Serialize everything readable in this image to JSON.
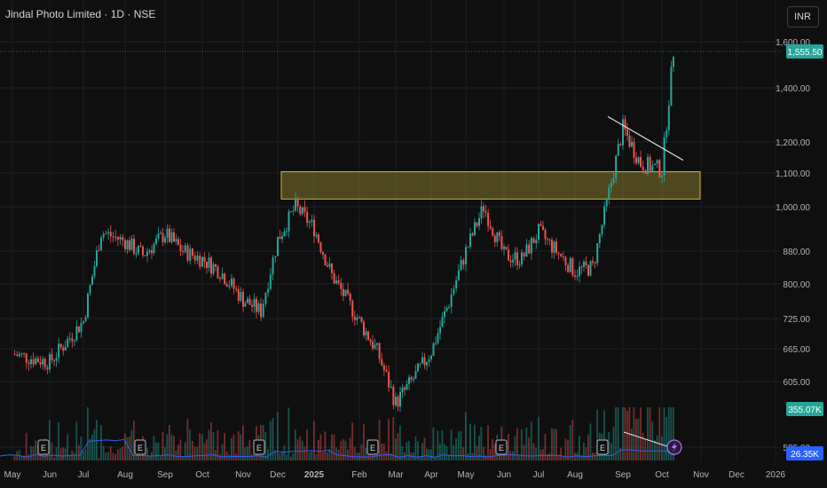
{
  "header": {
    "title": "Jindal Photo Limited · 1D · NSE",
    "currency": "INR"
  },
  "chart_data": {
    "type": "candlestick",
    "title": "Jindal Photo Limited · 1D · NSE",
    "price_scale": "log",
    "y_ticks": [
      "1,600.00",
      "1,400.00",
      "1,200.00",
      "1,100.00",
      "1,000.00",
      "880.00",
      "800.00",
      "725.00",
      "665.00",
      "605.00",
      "505.00"
    ],
    "y_tick_values": [
      1600,
      1400,
      1200,
      1100,
      1000,
      880,
      800,
      725,
      665,
      605,
      505
    ],
    "x_ticks": [
      "May",
      "Jun",
      "Jul",
      "Aug",
      "Sep",
      "Oct",
      "Nov",
      "Dec",
      "2025",
      "Feb",
      "Mar",
      "Apr",
      "May",
      "Jun",
      "Jul",
      "Aug",
      "Sep",
      "Oct",
      "Nov",
      "Dec",
      "2026"
    ],
    "last_price": "1,555.50",
    "last_price_value": 1555.5,
    "volume_label": "355.07K",
    "volume_avg_label": "26.35K",
    "earnings_marker": "E",
    "earnings_months": [
      "Jul",
      "Aug",
      "Nov",
      "Feb",
      "Jun",
      "Aug"
    ],
    "price_path": [
      [
        "May",
        655
      ],
      [
        "Jun",
        640
      ],
      [
        "Jul",
        720
      ],
      [
        "Jul",
        930
      ],
      [
        "Aug",
        905
      ],
      [
        "Aug",
        870
      ],
      [
        "Sep",
        925
      ],
      [
        "Sep",
        880
      ],
      [
        "Oct",
        860
      ],
      [
        "Oct",
        830
      ],
      [
        "Nov",
        765
      ],
      [
        "Nov",
        740
      ],
      [
        "Dec",
        910
      ],
      [
        "Dec",
        1000
      ],
      [
        "2025",
        940
      ],
      [
        "2025",
        820
      ],
      [
        "Feb",
        720
      ],
      [
        "Feb",
        660
      ],
      [
        "Mar",
        570
      ],
      [
        "Mar",
        610
      ],
      [
        "Apr",
        660
      ],
      [
        "Apr",
        760
      ],
      [
        "May",
        880
      ],
      [
        "May",
        1000
      ],
      [
        "Jun",
        870
      ],
      [
        "Jun",
        860
      ],
      [
        "Jul",
        930
      ],
      [
        "Jul",
        880
      ],
      [
        "Aug",
        830
      ],
      [
        "Aug",
        840
      ],
      [
        "Sep",
        1250
      ],
      [
        "Sep",
        1130
      ],
      [
        "Oct",
        1110
      ],
      [
        "Oct",
        1555.5
      ]
    ],
    "zone": {
      "from": "Dec",
      "to": "Oct",
      "low": 1040,
      "high": 1085,
      "color": "#c8b43c"
    },
    "trendline": {
      "from": [
        "Sep",
        1290
      ],
      "to": [
        "Oct",
        1140
      ]
    },
    "colors": {
      "up": "#26a69a",
      "down": "#ef5350",
      "volume_avg": "#2962ff",
      "last_price": "#26a69a"
    }
  }
}
